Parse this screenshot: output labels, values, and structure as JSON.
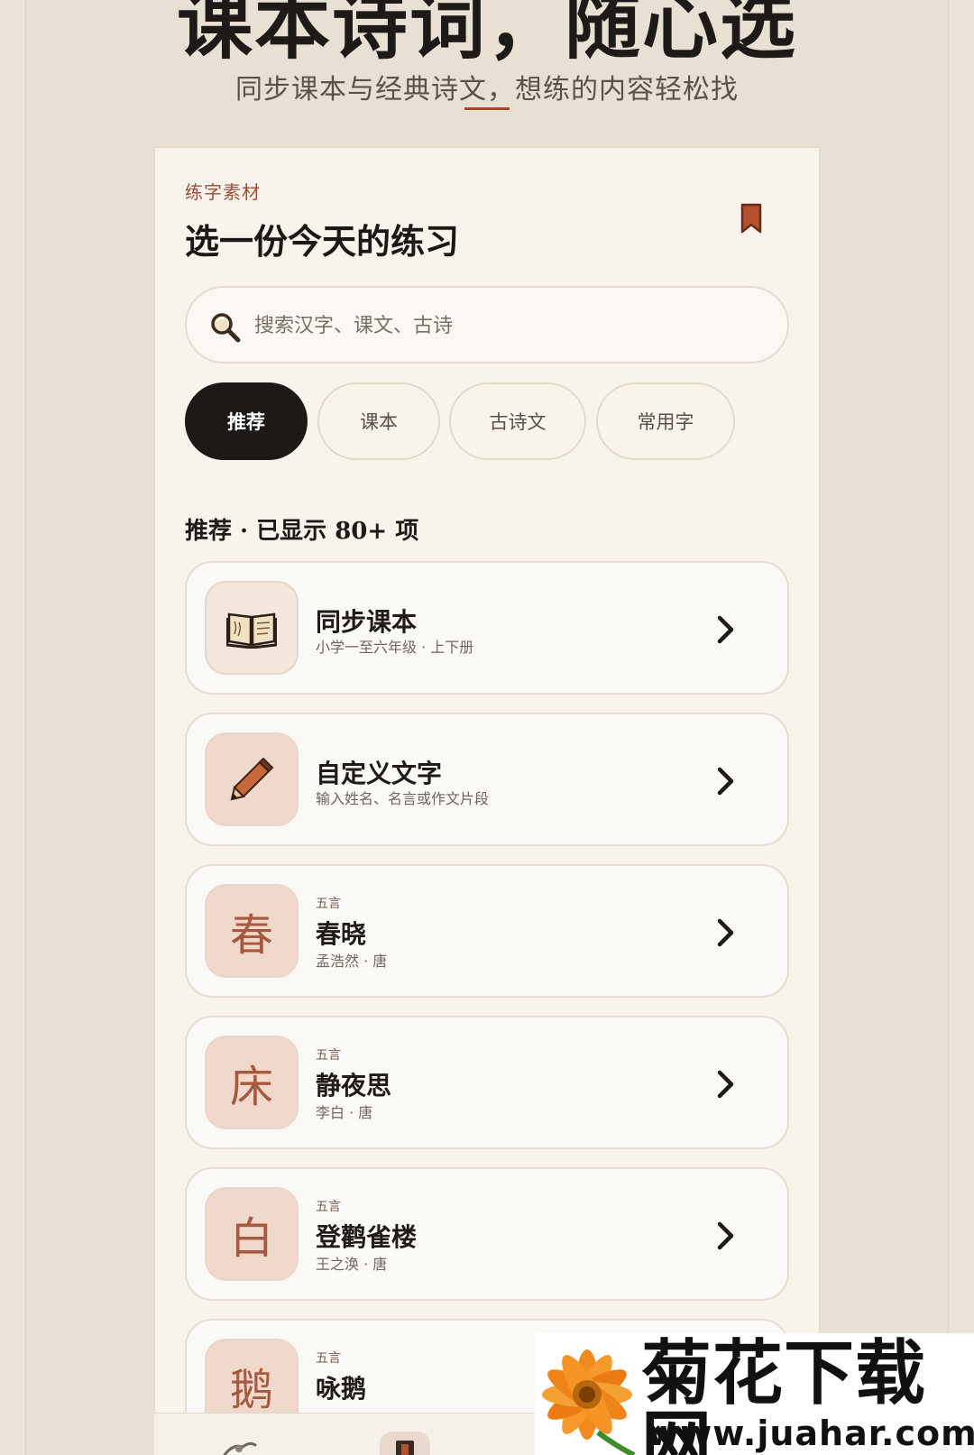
{
  "hero": {
    "title": "课本诗词，随心选",
    "subtitle": "同步课本与经典诗文，想练的内容轻松找"
  },
  "panel": {
    "eyebrow": "练字素材",
    "title": "选一份今天的练习",
    "bookmark_icon": "bookmark-icon"
  },
  "search": {
    "placeholder": "搜索汉字、课文、古诗",
    "value": "",
    "icon": "search-icon"
  },
  "tabs": [
    {
      "label": "推荐",
      "active": true
    },
    {
      "label": "课本",
      "active": false
    },
    {
      "label": "古诗文",
      "active": false
    },
    {
      "label": "常用字",
      "active": false
    }
  ],
  "section": {
    "heading": "推荐 · 已显示 80+ 项"
  },
  "items": [
    {
      "icon": "book-icon",
      "title": "同步课本",
      "subtitle": "小学一至六年级 · 上下册"
    },
    {
      "icon": "pencil-icon",
      "title": "自定义文字",
      "subtitle": "输入姓名、名言或作文片段"
    },
    {
      "char": "春",
      "tag": "五言",
      "title": "春晓",
      "subtitle": "孟浩然 · 唐"
    },
    {
      "char": "床",
      "tag": "五言",
      "title": "静夜思",
      "subtitle": "李白 · 唐"
    },
    {
      "char": "白",
      "tag": "五言",
      "title": "登鹳雀楼",
      "subtitle": "王之涣 · 唐"
    },
    {
      "char": "鹅",
      "tag": "五言",
      "title": "咏鹅",
      "subtitle": ""
    }
  ],
  "watermark": {
    "title": "菊花下载网",
    "url": "www.juahar.com"
  },
  "colors": {
    "background": "#ece3d7",
    "card": "#f8f4ec",
    "accent": "#a44b2f",
    "tab_active": "#1c1917",
    "thumb_peach": "#f0d8ca"
  }
}
